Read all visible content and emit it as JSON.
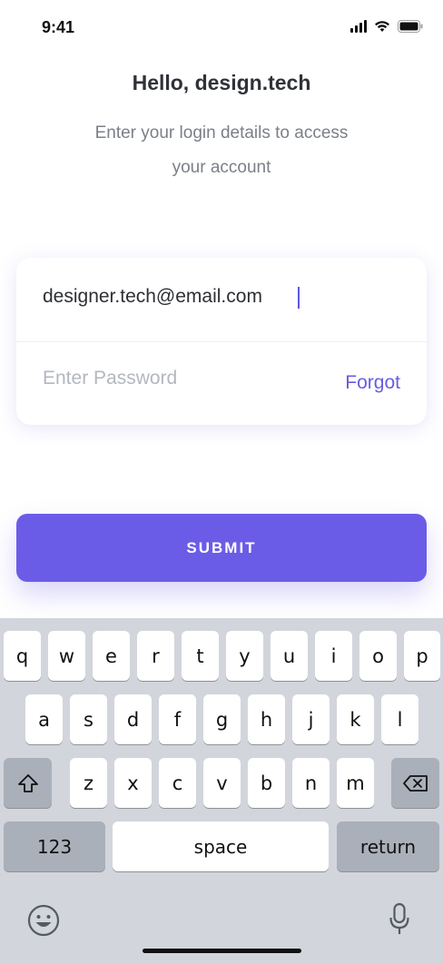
{
  "status_bar": {
    "time": "9:41"
  },
  "header": {
    "title": "Hello, design.tech",
    "subtitle": "Enter your login details to access your account"
  },
  "form": {
    "email_value": "designer.tech@email.com",
    "password_placeholder": "Enter Password",
    "forgot_label": "Forgot",
    "submit_label": "SUBMIT"
  },
  "keyboard": {
    "row1": [
      "q",
      "w",
      "e",
      "r",
      "t",
      "y",
      "u",
      "i",
      "o",
      "p"
    ],
    "row2": [
      "a",
      "s",
      "d",
      "f",
      "g",
      "h",
      "j",
      "k",
      "l"
    ],
    "row3": [
      "z",
      "x",
      "c",
      "v",
      "b",
      "n",
      "m"
    ],
    "numbers_label": "123",
    "space_label": "space",
    "return_label": "return",
    "icons": [
      "shift-icon",
      "backspace-icon",
      "emoji-icon",
      "microphone-icon"
    ]
  },
  "colors": {
    "accent": "#6b5ce7",
    "keyboard_bg": "#d2d5db"
  }
}
